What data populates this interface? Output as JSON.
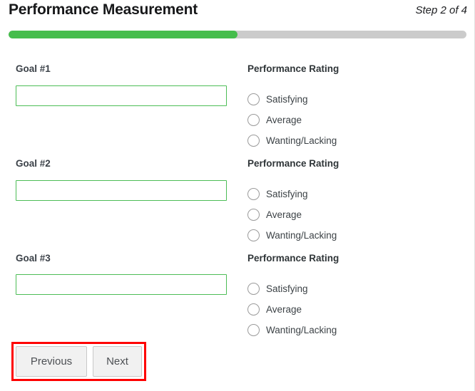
{
  "header": {
    "title": "Performance Measurement",
    "step_indicator": "Step 2 of 4"
  },
  "progress": {
    "percent": 50,
    "fill_color": "#45bd4c",
    "track_color": "#cbcbcb"
  },
  "goals": [
    {
      "label": "Goal #1",
      "value": "",
      "placeholder": ""
    },
    {
      "label": "Goal #2",
      "value": "",
      "placeholder": ""
    },
    {
      "label": "Goal #3",
      "value": "",
      "placeholder": ""
    }
  ],
  "rating_groups": [
    {
      "title": "Performance Rating",
      "options": [
        {
          "label": "Satisfying",
          "selected": false
        },
        {
          "label": "Average",
          "selected": false
        },
        {
          "label": "Wanting/Lacking",
          "selected": false
        }
      ]
    },
    {
      "title": "Performance Rating",
      "options": [
        {
          "label": "Satisfying",
          "selected": false
        },
        {
          "label": "Average",
          "selected": false
        },
        {
          "label": "Wanting/Lacking",
          "selected": false
        }
      ]
    },
    {
      "title": "Performance Rating",
      "options": [
        {
          "label": "Satisfying",
          "selected": false
        },
        {
          "label": "Average",
          "selected": false
        },
        {
          "label": "Wanting/Lacking",
          "selected": false
        }
      ]
    }
  ],
  "footer": {
    "previous_label": "Previous",
    "next_label": "Next",
    "highlight_color": "#fe0000"
  },
  "colors": {
    "input_border": "#4cbd56",
    "label_text": "#3b4148",
    "body_text": "#3c4246"
  }
}
